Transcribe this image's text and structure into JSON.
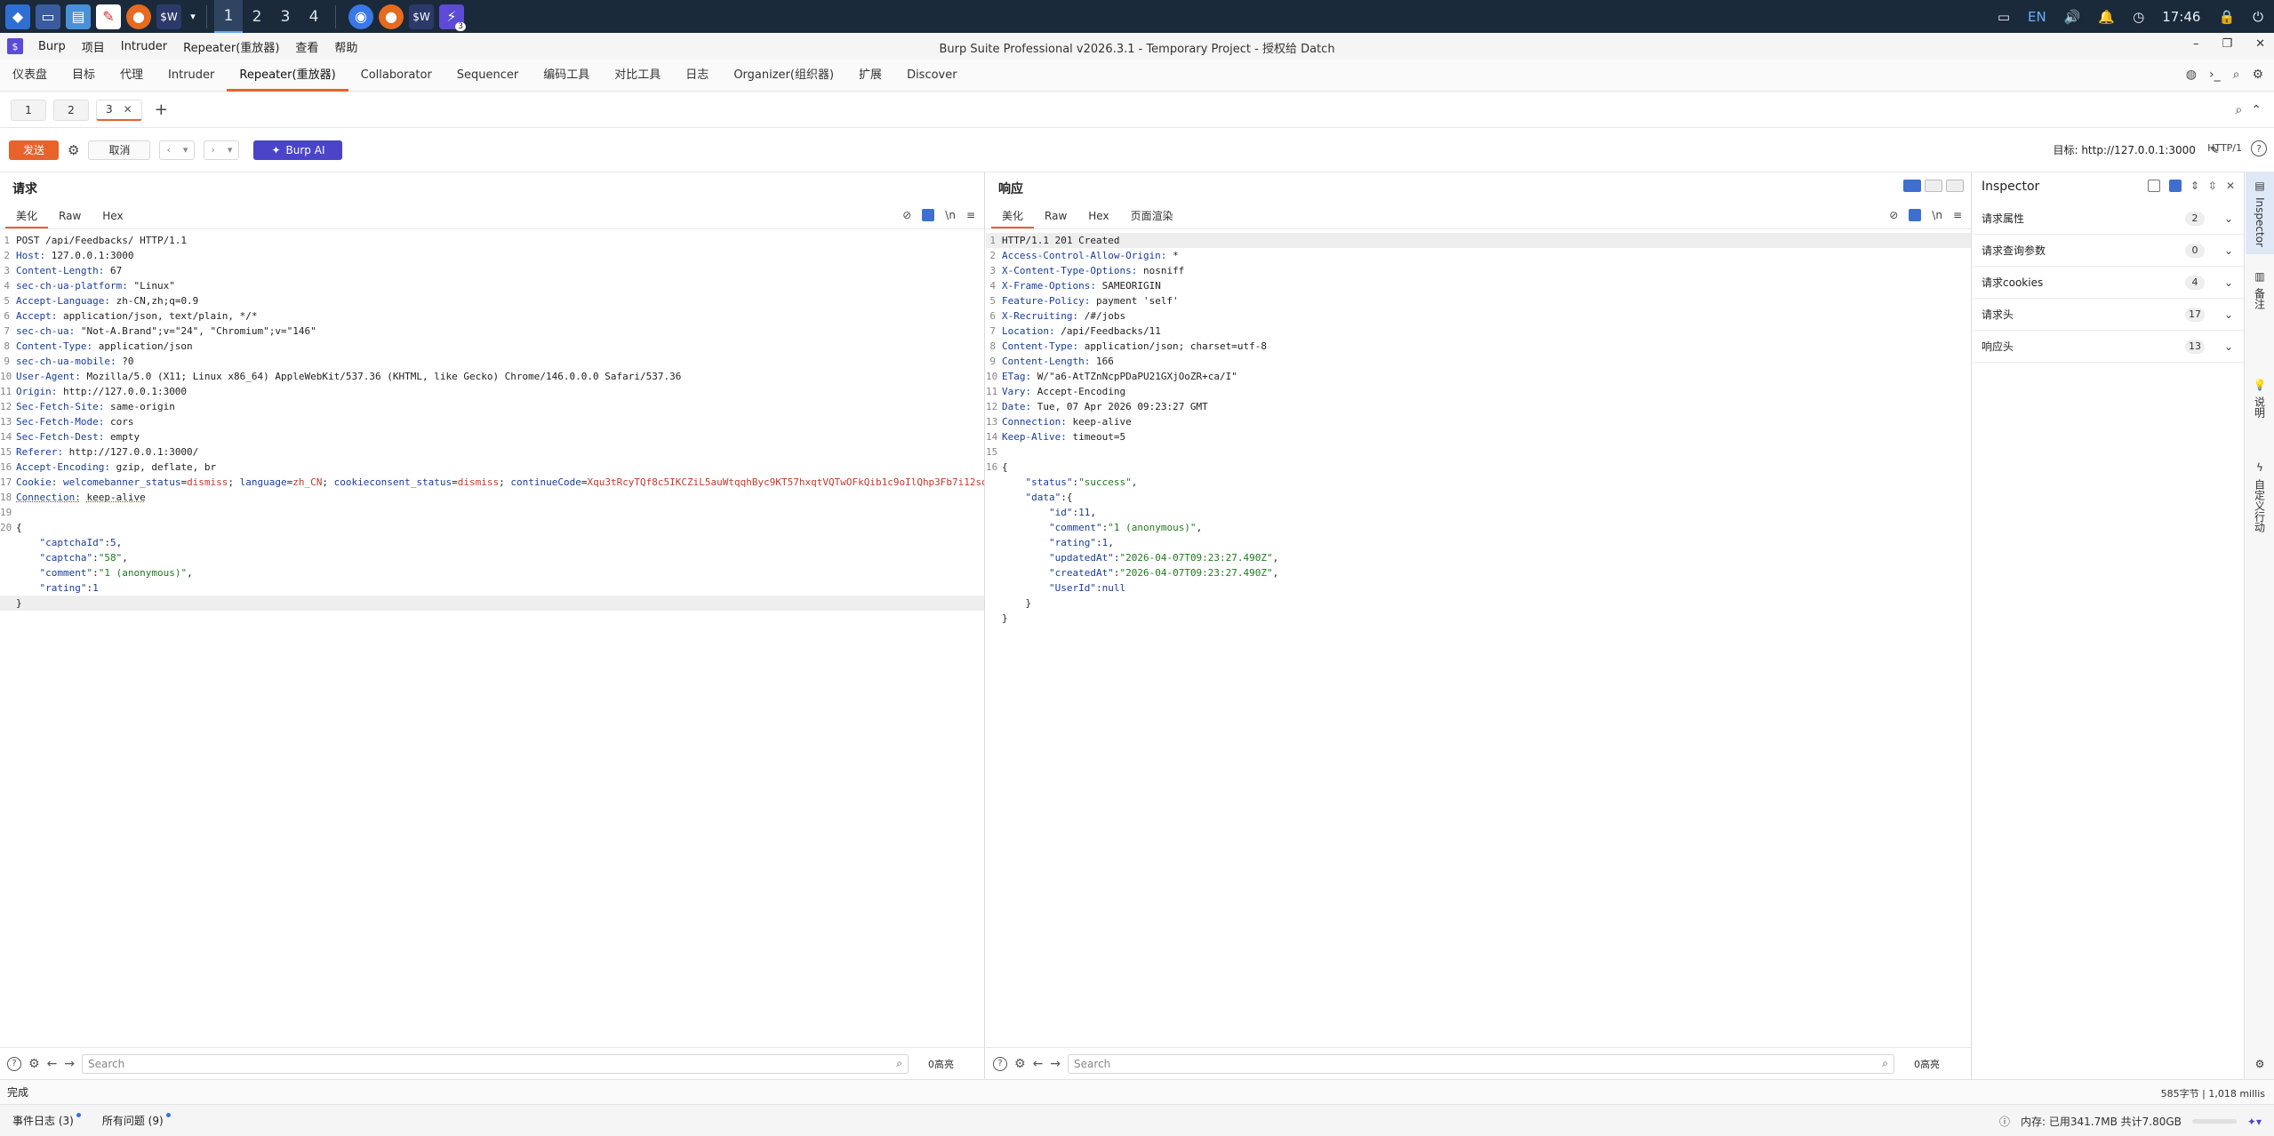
{
  "taskbar": {
    "workspaces": [
      "1",
      "2",
      "3",
      "4"
    ],
    "badge": "3",
    "lang": "EN",
    "clock": "17:46"
  },
  "window": {
    "title": "Burp Suite Professional v2026.3.1 - Temporary Project - 授权给 Datch",
    "menu": [
      "Burp",
      "项目",
      "Intruder",
      "Repeater(重放器)",
      "查看",
      "帮助"
    ]
  },
  "tooltabs": [
    "仪表盘",
    "目标",
    "代理",
    "Intruder",
    "Repeater(重放器)",
    "Collaborator",
    "Sequencer",
    "编码工具",
    "对比工具",
    "日志",
    "Organizer(组织器)",
    "扩展",
    "Discover"
  ],
  "reqtabs": [
    "1",
    "2",
    "3"
  ],
  "actions": {
    "send": "发送",
    "cancel": "取消",
    "burp_ai": "Burp AI",
    "target": "目标: http://127.0.0.1:3000",
    "http_version": "HTTP/1"
  },
  "request": {
    "title": "请求",
    "tabs": [
      "美化",
      "Raw",
      "Hex"
    ],
    "search_placeholder": "Search",
    "hits": "0高亮"
  },
  "response": {
    "title": "响应",
    "tabs": [
      "美化",
      "Raw",
      "Hex",
      "页面渲染"
    ],
    "search_placeholder": "Search",
    "hits": "0高亮"
  },
  "inspector": {
    "title": "Inspector",
    "rows": [
      {
        "label": "请求属性",
        "count": "2"
      },
      {
        "label": "请求查询参数",
        "count": "0"
      },
      {
        "label": "请求cookies",
        "count": "4"
      },
      {
        "label": "请求头",
        "count": "17"
      },
      {
        "label": "响应头",
        "count": "13"
      }
    ]
  },
  "siderail": [
    "Inspector",
    "备注",
    "说明",
    "自定义行动"
  ],
  "status": {
    "left": "完成",
    "right": "585字节 | 1,018 millis"
  },
  "bottom": {
    "events": "事件日志 (3)",
    "issues": "所有问题 (9)",
    "memory": "内存: 已用341.7MB 共计7.80GB"
  },
  "colors": {
    "accent": "#e8622a",
    "burp_ai": "#4a45c8",
    "header_key": "#1a3d9a",
    "cookie_value": "#c0392b",
    "json_string": "#1f7a1f"
  }
}
